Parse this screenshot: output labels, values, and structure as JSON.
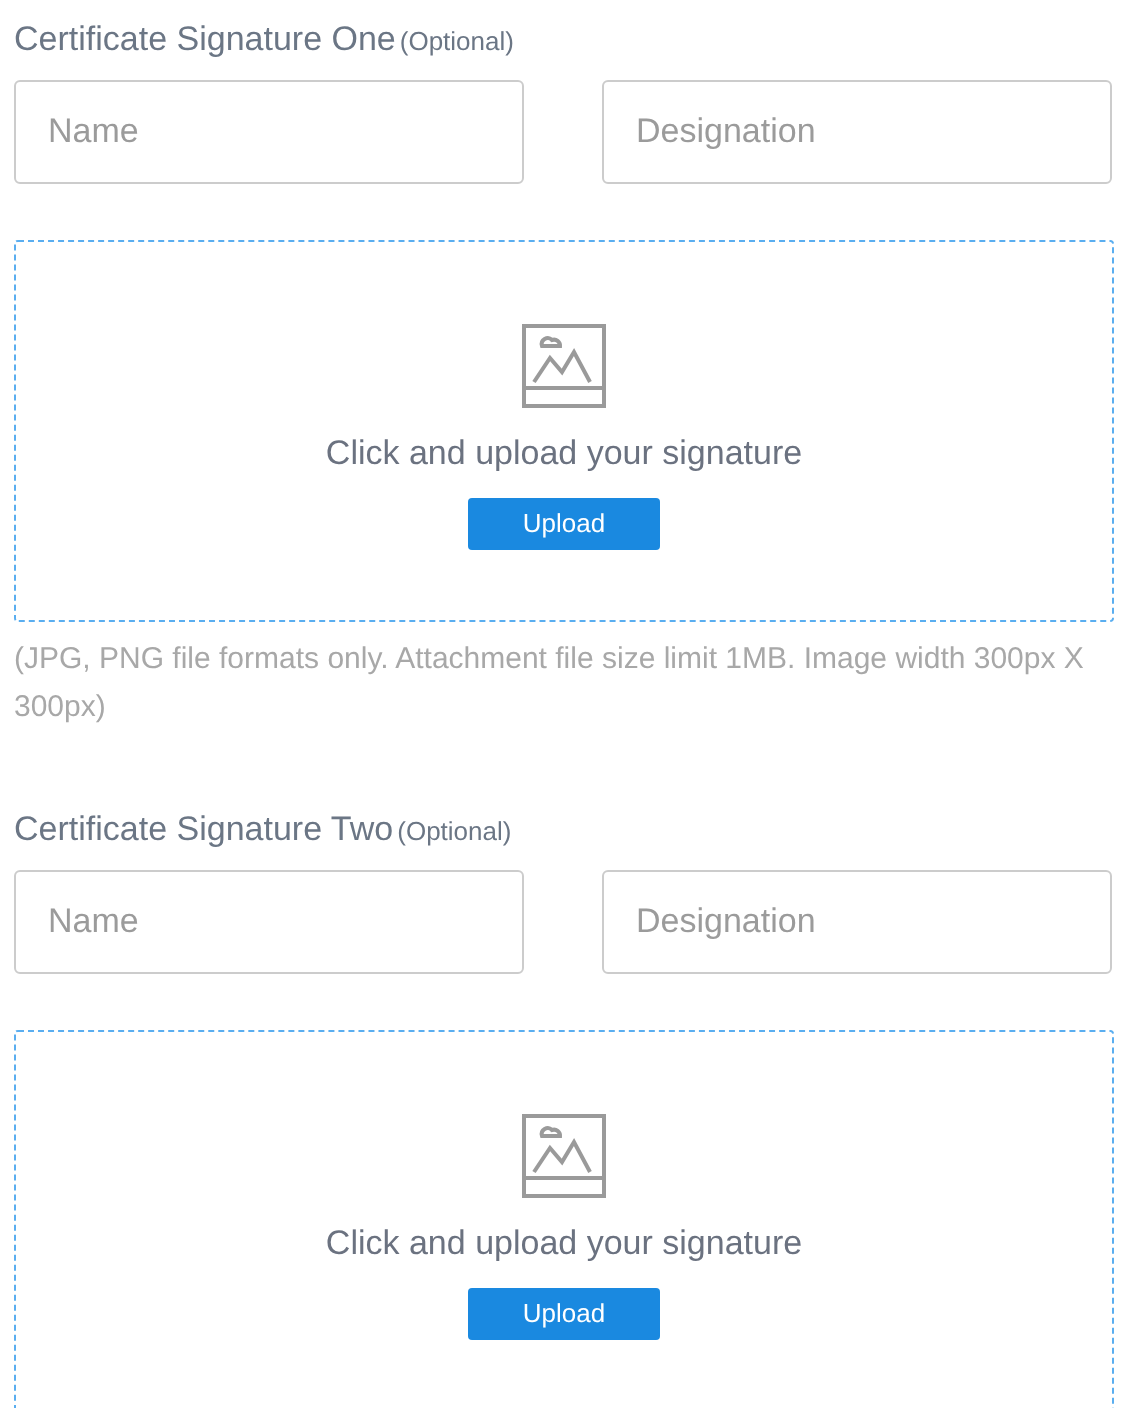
{
  "sections": [
    {
      "title": "Certificate Signature One",
      "optional": "(Optional)",
      "name_field": {
        "placeholder": "Name"
      },
      "designation_field": {
        "placeholder": "Designation"
      },
      "upload": {
        "prompt": "Click and upload your signature",
        "button": "Upload"
      },
      "note": "(JPG, PNG file formats only. Attachment file size limit 1MB. Image width 300px X 300px)"
    },
    {
      "title": "Certificate Signature Two",
      "optional": "(Optional)",
      "name_field": {
        "placeholder": "Name"
      },
      "designation_field": {
        "placeholder": "Designation"
      },
      "upload": {
        "prompt": "Click and upload your signature",
        "button": "Upload"
      }
    }
  ]
}
